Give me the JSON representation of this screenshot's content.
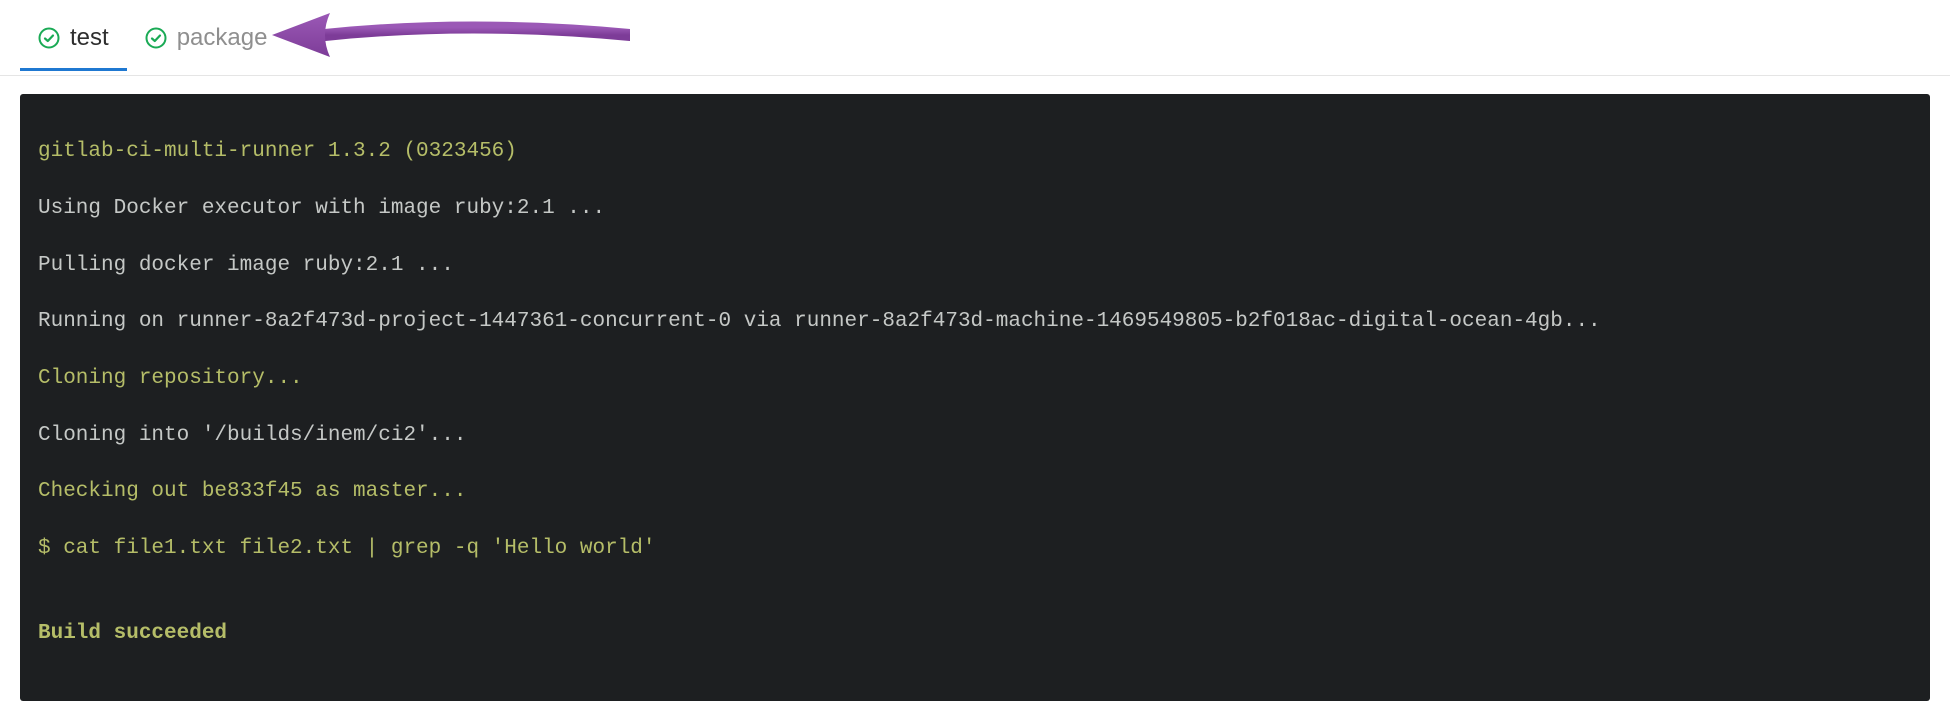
{
  "tabs": [
    {
      "label": "test",
      "active": true,
      "status": "passed"
    },
    {
      "label": "package",
      "active": false,
      "status": "passed"
    }
  ],
  "annotation": {
    "type": "arrow",
    "color": "#8e44ad",
    "target": "tab-package"
  },
  "terminal": {
    "lines": [
      {
        "text": "gitlab-ci-multi-runner 1.3.2 (0323456)",
        "style": "green"
      },
      {
        "text": "Using Docker executor with image ruby:2.1 ...",
        "style": "white"
      },
      {
        "text": "Pulling docker image ruby:2.1 ...",
        "style": "white"
      },
      {
        "text": "Running on runner-8a2f473d-project-1447361-concurrent-0 via runner-8a2f473d-machine-1469549805-b2f018ac-digital-ocean-4gb...",
        "style": "white"
      },
      {
        "text": "Cloning repository...",
        "style": "green"
      },
      {
        "text": "Cloning into '/builds/inem/ci2'...",
        "style": "white"
      },
      {
        "text": "Checking out be833f45 as master...",
        "style": "green"
      },
      {
        "text": "$ cat file1.txt file2.txt | grep -q 'Hello world'",
        "style": "green"
      },
      {
        "text": "",
        "style": "white"
      },
      {
        "text": "Build succeeded",
        "style": "bold-green"
      }
    ]
  },
  "colors": {
    "accent": "#1f78d1",
    "termBg": "#1d1f21",
    "termGreen": "#b5bd68",
    "termWhite": "#c5c8c6",
    "arrow": "#8e44ad",
    "successIcon": "#1aaa55"
  }
}
